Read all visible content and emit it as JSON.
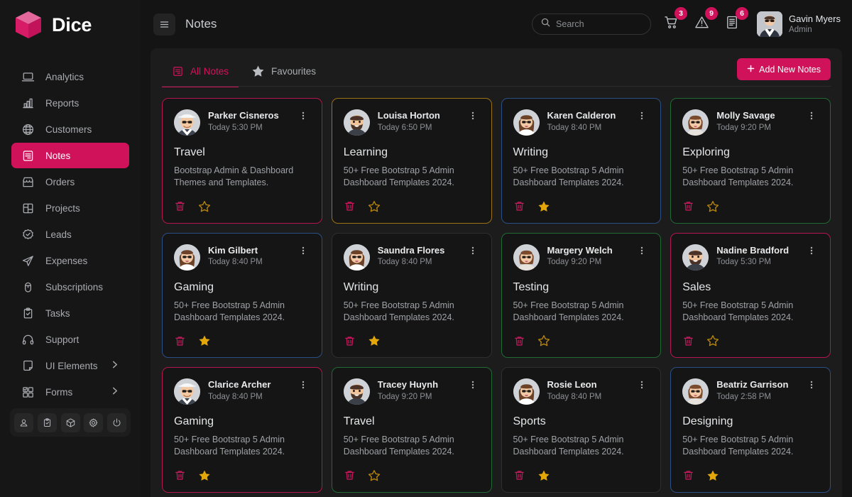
{
  "brand": {
    "name": "Dice",
    "logo_icon": "cube-logo-icon"
  },
  "sidebar": {
    "items": [
      {
        "label": "Analytics",
        "icon": "laptop-icon",
        "active": false,
        "has_chevron": false
      },
      {
        "label": "Reports",
        "icon": "bar-chart-icon",
        "active": false,
        "has_chevron": false
      },
      {
        "label": "Customers",
        "icon": "globe-icon",
        "active": false,
        "has_chevron": false
      },
      {
        "label": "Notes",
        "icon": "note-icon",
        "active": true,
        "has_chevron": false
      },
      {
        "label": "Orders",
        "icon": "store-icon",
        "active": false,
        "has_chevron": false
      },
      {
        "label": "Projects",
        "icon": "layout-icon",
        "active": false,
        "has_chevron": false
      },
      {
        "label": "Leads",
        "icon": "badge-check-icon",
        "active": false,
        "has_chevron": false
      },
      {
        "label": "Expenses",
        "icon": "send-icon",
        "active": false,
        "has_chevron": false
      },
      {
        "label": "Subscriptions",
        "icon": "mouse-icon",
        "active": false,
        "has_chevron": false
      },
      {
        "label": "Tasks",
        "icon": "clipboard-check-icon",
        "active": false,
        "has_chevron": false
      },
      {
        "label": "Support",
        "icon": "headset-icon",
        "active": false,
        "has_chevron": false
      },
      {
        "label": "UI Elements",
        "icon": "sticky-note-icon",
        "active": false,
        "has_chevron": true
      },
      {
        "label": "Forms",
        "icon": "grid-check-icon",
        "active": false,
        "has_chevron": true
      }
    ],
    "tools": [
      {
        "icon": "user-icon"
      },
      {
        "icon": "clipboard-icon"
      },
      {
        "icon": "box-icon"
      },
      {
        "icon": "gear-icon"
      },
      {
        "icon": "power-icon"
      }
    ]
  },
  "header": {
    "menu_icon": "hamburger-icon",
    "title": "Notes",
    "search": {
      "placeholder": "Search",
      "value": "",
      "icon": "search-icon"
    },
    "badges": [
      {
        "icon": "cart-icon",
        "count": "3"
      },
      {
        "icon": "warning-icon",
        "count": "9"
      },
      {
        "icon": "document-icon",
        "count": "6"
      }
    ],
    "profile": {
      "name": "Gavin Myers",
      "role": "Admin",
      "avatar": "user-avatar"
    }
  },
  "panel": {
    "tabs": [
      {
        "label": "All Notes",
        "icon": "note-list-icon",
        "active": true
      },
      {
        "label": "Favourites",
        "icon": "star-icon",
        "active": false
      }
    ],
    "add_button": {
      "label": "Add New Notes",
      "icon": "plus-icon"
    }
  },
  "colors": {
    "accent": "#cf1259",
    "pink": "#b4144f",
    "amber": "#9b7312",
    "blue": "#2a4f86",
    "green": "#1f6b33",
    "dark": "#2e2e2e",
    "star_filled": "#e3a70a",
    "star_outline": "#b8860b",
    "trash": "#c2185b"
  },
  "notes": [
    {
      "name": "Parker Cisneros",
      "time": "Today 5:30 PM",
      "title": "Travel",
      "body": "Bootstrap Admin & Dashboard Themes and Templates.",
      "border": "pink",
      "avatar": "man-hat",
      "favourite": false
    },
    {
      "name": "Louisa Horton",
      "time": "Today 6:50 PM",
      "title": "Learning",
      "body": "50+ Free Bootstrap 5 Admin Dashboard Templates 2024.",
      "border": "amber",
      "avatar": "man-beard",
      "favourite": false
    },
    {
      "name": "Karen Calderon",
      "time": "Today 8:40 PM",
      "title": "Writing",
      "body": "50+ Free Bootstrap 5 Admin Dashboard Templates 2024.",
      "border": "blue",
      "avatar": "woman-long",
      "favourite": true
    },
    {
      "name": "Molly Savage",
      "time": "Today 9:20 PM",
      "title": "Exploring",
      "body": "50+ Free Bootstrap 5 Admin Dashboard Templates 2024.",
      "border": "green",
      "avatar": "woman-bob",
      "favourite": false
    },
    {
      "name": "Kim Gilbert",
      "time": "Today 8:40 PM",
      "title": "Gaming",
      "body": "50+ Free Bootstrap 5 Admin Dashboard Templates 2024.",
      "border": "blue",
      "avatar": "woman-long",
      "favourite": true
    },
    {
      "name": "Saundra Flores",
      "time": "Today 8:40 PM",
      "title": "Writing",
      "body": "50+ Free Bootstrap 5 Admin Dashboard Templates 2024.",
      "border": "dark",
      "avatar": "woman-long",
      "favourite": true
    },
    {
      "name": "Margery Welch",
      "time": "Today 9:20 PM",
      "title": "Testing",
      "body": "50+ Free Bootstrap 5 Admin Dashboard Templates 2024.",
      "border": "green",
      "avatar": "woman-bob",
      "favourite": false
    },
    {
      "name": "Nadine Bradford",
      "time": "Today 5:30 PM",
      "title": "Sales",
      "body": "50+ Free Bootstrap 5 Admin Dashboard Templates 2024.",
      "border": "pink",
      "avatar": "man-beard",
      "favourite": false
    },
    {
      "name": "Clarice Archer",
      "time": "Today 8:40 PM",
      "title": "Gaming",
      "body": "50+ Free Bootstrap 5 Admin Dashboard Templates 2024.",
      "border": "pink",
      "avatar": "man-hat",
      "favourite": true
    },
    {
      "name": "Tracey Huynh",
      "time": "Today 9:20 PM",
      "title": "Travel",
      "body": "50+ Free Bootstrap 5 Admin Dashboard Templates 2024.",
      "border": "green",
      "avatar": "man-beard",
      "favourite": false
    },
    {
      "name": "Rosie Leon",
      "time": "Today 8:40 PM",
      "title": "Sports",
      "body": "50+ Free Bootstrap 5 Admin Dashboard Templates 2024.",
      "border": "dark",
      "avatar": "woman-long",
      "favourite": true
    },
    {
      "name": "Beatriz Garrison",
      "time": "Today 2:58 PM",
      "title": "Designing",
      "body": "50+ Free Bootstrap 5 Admin Dashboard Templates 2024.",
      "border": "blue",
      "avatar": "woman-bob",
      "favourite": true
    }
  ]
}
